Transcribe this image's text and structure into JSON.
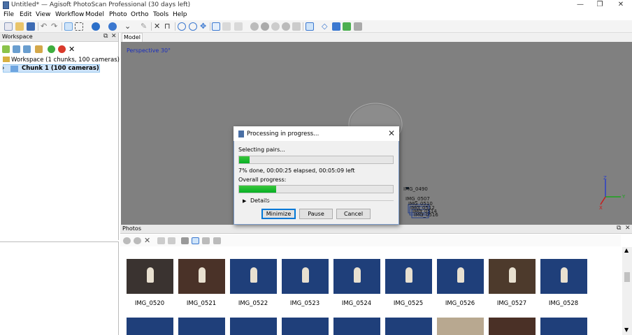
{
  "window": {
    "title": "Untitled* — Agisoft PhotoScan Professional (30 days left)",
    "controls": {
      "minimize": "—",
      "restore": "❐",
      "close": "✕"
    }
  },
  "menu": [
    "File",
    "Edit",
    "View",
    "Workflow",
    "Model",
    "Photo",
    "Ortho",
    "Tools",
    "Help"
  ],
  "workspace": {
    "title": "Workspace",
    "tree_root": "Workspace (1 chunks, 100 cameras)",
    "chunk": "Chunk 1 (100 cameras)"
  },
  "model": {
    "tab": "Model",
    "view_label": "Perspective 30°",
    "camera_labels": [
      "IMG_0490",
      "IMG_0507",
      "IMG_0510",
      "IMG_0512",
      "IMG_0514",
      "IMG_0516"
    ]
  },
  "dialog": {
    "title": "Processing in progress...",
    "stage": "Selecting pairs...",
    "stage_progress": 0.07,
    "status": "7% done, 00:00:25 elapsed, 00:05:09 left",
    "overall_label": "Overall progress:",
    "overall_progress": 0.24,
    "details": "Details",
    "buttons": {
      "minimize": "Minimize",
      "pause": "Pause",
      "cancel": "Cancel"
    }
  },
  "photos": {
    "title": "Photos",
    "items": [
      "IMG_0520",
      "IMG_0521",
      "IMG_0522",
      "IMG_0523",
      "IMG_0524",
      "IMG_0525",
      "IMG_0526",
      "IMG_0527",
      "IMG_0528"
    ]
  }
}
